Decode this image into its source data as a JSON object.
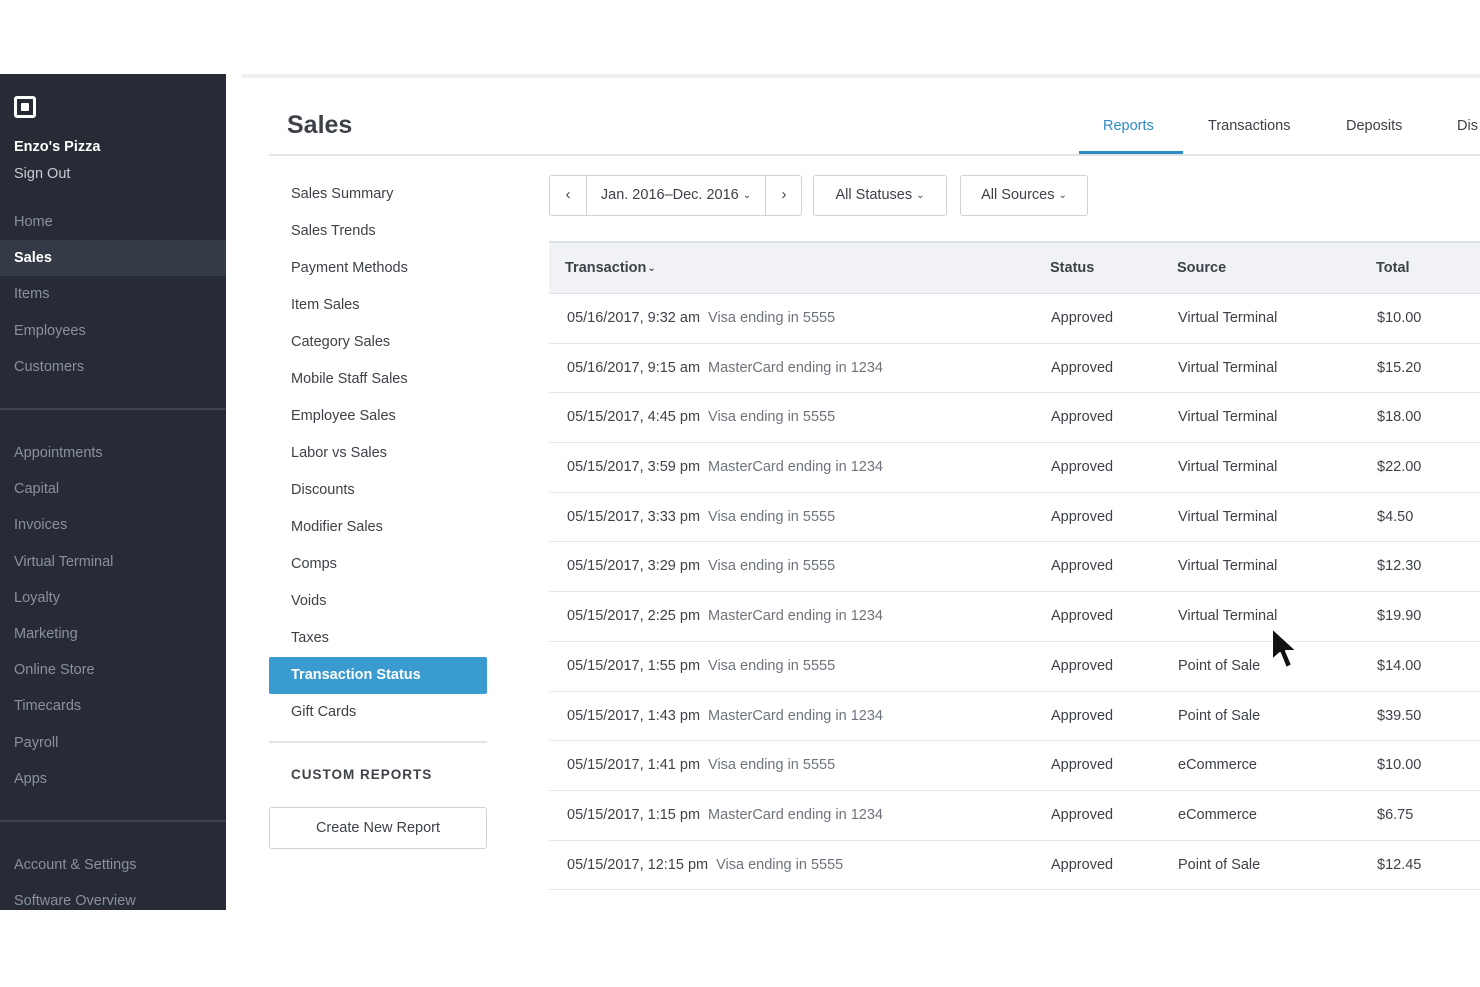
{
  "sidebar": {
    "business_name": "Enzo's Pizza",
    "sign_out": "Sign Out",
    "group1": [
      "Home",
      "Sales",
      "Items",
      "Employees",
      "Customers"
    ],
    "group2": [
      "Appointments",
      "Capital",
      "Invoices",
      "Virtual Terminal",
      "Loyalty",
      "Marketing",
      "Online Store",
      "Timecards",
      "Payroll",
      "Apps"
    ],
    "group3": [
      "Account & Settings",
      "Software Overview"
    ],
    "active": "Sales"
  },
  "header": {
    "title": "Sales",
    "tabs": [
      "Reports",
      "Transactions",
      "Deposits",
      "Dis"
    ],
    "active_tab": "Reports"
  },
  "report_menu": {
    "items": [
      "Sales Summary",
      "Sales Trends",
      "Payment Methods",
      "Item Sales",
      "Category Sales",
      "Mobile Staff Sales",
      "Employee Sales",
      "Labor vs Sales",
      "Discounts",
      "Modifier Sales",
      "Comps",
      "Voids",
      "Taxes",
      "Transaction Status",
      "Gift Cards"
    ],
    "active": "Transaction Status",
    "custom_reports_title": "CUSTOM REPORTS",
    "create_button": "Create New Report"
  },
  "filters": {
    "prev": "‹",
    "date_range": "Jan. 2016–Dec. 2016",
    "next": "›",
    "status": "All Statuses",
    "sources": "All Sources"
  },
  "table": {
    "columns": [
      "Transaction",
      "Status",
      "Source",
      "Total"
    ],
    "rows": [
      {
        "datetime": "05/16/2017,  9:32 am",
        "card": "Visa ending in 5555",
        "status": "Approved",
        "source": "Virtual Terminal",
        "total": "$10.00"
      },
      {
        "datetime": "05/16/2017,  9:15 am",
        "card": "MasterCard ending in 1234",
        "status": "Approved",
        "source": "Virtual Terminal",
        "total": "$15.20"
      },
      {
        "datetime": "05/15/2017,  4:45 pm",
        "card": "Visa ending in 5555",
        "status": "Approved",
        "source": "Virtual Terminal",
        "total": "$18.00"
      },
      {
        "datetime": "05/15/2017,  3:59 pm",
        "card": "MasterCard ending in 1234",
        "status": "Approved",
        "source": "Virtual Terminal",
        "total": "$22.00"
      },
      {
        "datetime": "05/15/2017,  3:33 pm",
        "card": "Visa ending in 5555",
        "status": "Approved",
        "source": "Virtual Terminal",
        "total": "$4.50"
      },
      {
        "datetime": "05/15/2017,  3:29 pm",
        "card": "Visa ending in 5555",
        "status": "Approved",
        "source": "Virtual Terminal",
        "total": "$12.30"
      },
      {
        "datetime": "05/15/2017,  2:25 pm",
        "card": "MasterCard ending in 1234",
        "status": "Approved",
        "source": "Virtual Terminal",
        "total": "$19.90"
      },
      {
        "datetime": "05/15/2017,  1:55 pm",
        "card": "Visa ending in 5555",
        "status": "Approved",
        "source": "Point of Sale",
        "total": "$14.00"
      },
      {
        "datetime": "05/15/2017,  1:43 pm",
        "card": "MasterCard ending in 1234",
        "status": "Approved",
        "source": "Point of Sale",
        "total": "$39.50"
      },
      {
        "datetime": "05/15/2017,  1:41 pm",
        "card": "Visa ending in 5555",
        "status": "Approved",
        "source": "eCommerce",
        "total": "$10.00"
      },
      {
        "datetime": "05/15/2017,  1:15 pm",
        "card": "MasterCard ending in 1234",
        "status": "Approved",
        "source": "eCommerce",
        "total": "$6.75"
      },
      {
        "datetime": "05/15/2017, 12:15 pm",
        "card": "Visa ending in 5555",
        "status": "Approved",
        "source": "Point of Sale",
        "total": "$12.45"
      }
    ]
  },
  "icons": {
    "logo": "square-logo-icon",
    "sort": "chevron-down-icon",
    "cursor": "mouse-pointer-icon"
  },
  "colors": {
    "sidebar_bg": "#262b36",
    "accent": "#2e8bc8",
    "active_menu": "#3a9bd0"
  }
}
